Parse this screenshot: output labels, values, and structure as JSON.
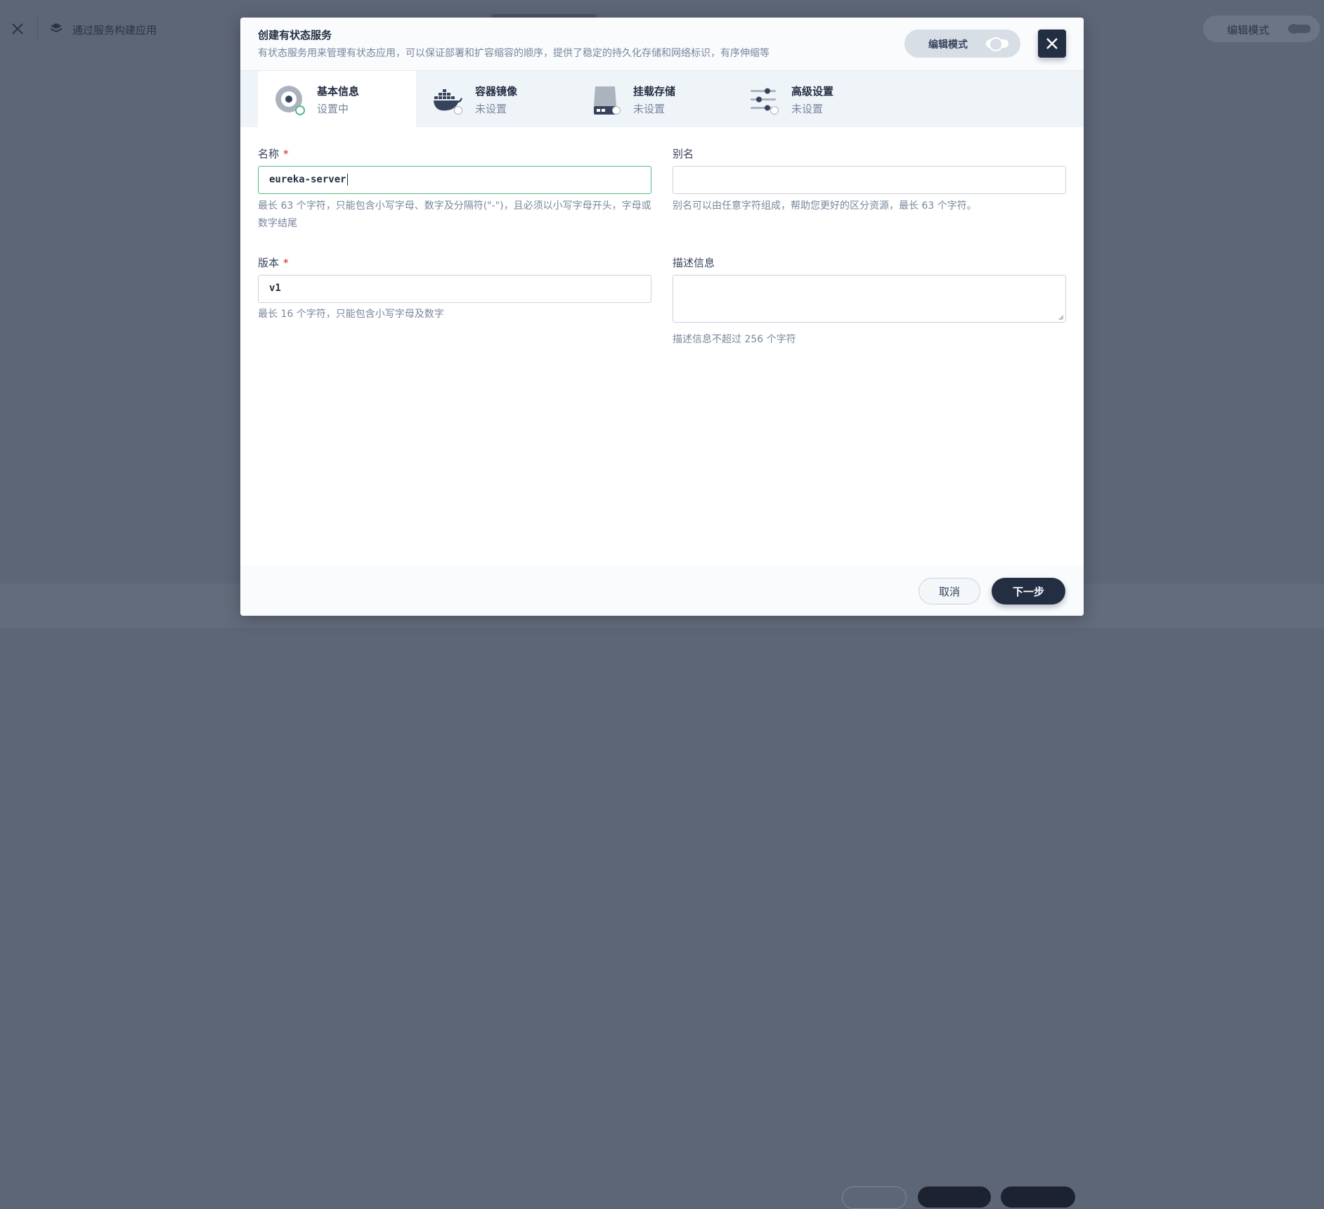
{
  "background": {
    "app_title": "通过服务构建应用",
    "edit_mode_label": "编辑模式"
  },
  "modal": {
    "title": "创建有状态服务",
    "description": "有状态服务用来管理有状态应用，可以保证部署和扩容缩容的顺序，提供了稳定的持久化存储和网络标识，有序伸缩等",
    "edit_mode_label": "编辑模式",
    "steps": [
      {
        "title": "基本信息",
        "status": "设置中",
        "icon": "basic-info-icon"
      },
      {
        "title": "容器镜像",
        "status": "未设置",
        "icon": "docker-icon"
      },
      {
        "title": "挂载存储",
        "status": "未设置",
        "icon": "storage-icon"
      },
      {
        "title": "高级设置",
        "status": "未设置",
        "icon": "sliders-icon"
      }
    ],
    "form": {
      "name": {
        "label": "名称",
        "required": "*",
        "value": "eureka-server",
        "hint": "最长 63 个字符，只能包含小写字母、数字及分隔符(\"-\")，且必须以小写字母开头，字母或数字结尾"
      },
      "alias": {
        "label": "别名",
        "value": "",
        "hint": "别名可以由任意字符组成，帮助您更好的区分资源，最长 63 个字符。"
      },
      "version": {
        "label": "版本",
        "required": "*",
        "value": "v1",
        "hint": "最长 16 个字符，只能包含小写字母及数字"
      },
      "description": {
        "label": "描述信息",
        "value": "",
        "hint": "描述信息不超过 256 个字符"
      }
    },
    "footer": {
      "cancel_label": "取消",
      "next_label": "下一步"
    }
  }
}
